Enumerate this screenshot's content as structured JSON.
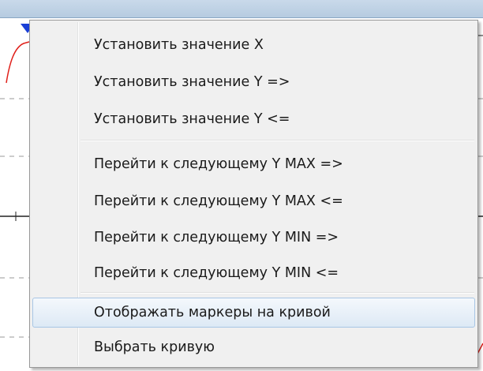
{
  "menu": {
    "items": [
      {
        "label": "Установить значение X"
      },
      {
        "label": "Установить значение Y =>"
      },
      {
        "label": "Установить значение Y <="
      },
      {
        "label": "Перейти к следующему Y MAX =>"
      },
      {
        "label": "Перейти к следующему Y MAX <="
      },
      {
        "label": "Перейти к следующему Y MIN =>"
      },
      {
        "label": "Перейти к следующему Y MIN <="
      },
      {
        "label": "Отображать маркеры на кривой"
      },
      {
        "label": "Выбрать кривую"
      }
    ],
    "highlighted_item": "Отображать маркеры на кривой"
  },
  "colors": {
    "menu_background": "#f0f0f0",
    "highlight_border": "#a8c6e5",
    "curve": "#e0201a",
    "marker": "#1a3fd6"
  }
}
